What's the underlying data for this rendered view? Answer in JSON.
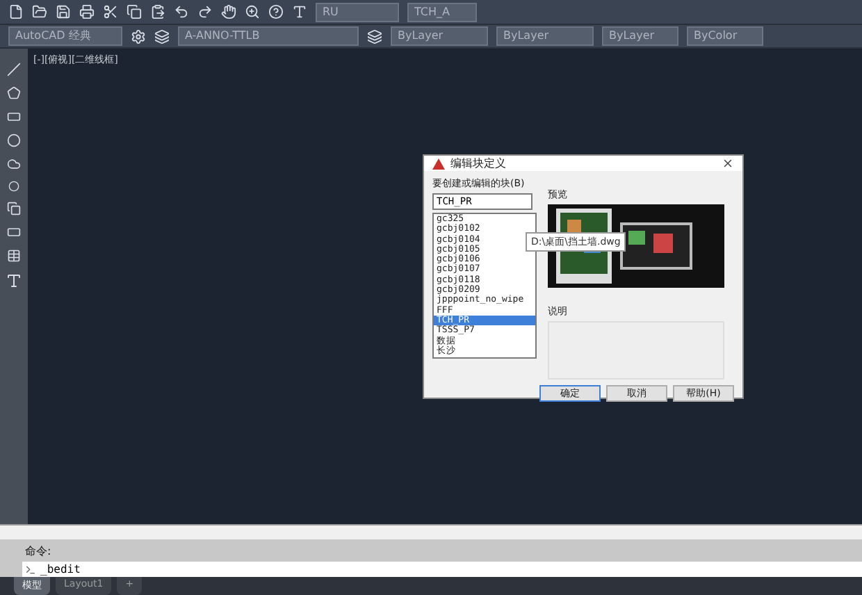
{
  "toolbar": {
    "style_field": "RU",
    "style_field_2": "TCH_A",
    "workspace": "AutoCAD 经典",
    "layer": "A-ANNO-TTLB",
    "color_field": "ByLayer",
    "linetype": "ByLayer",
    "lineweight": "ByLayer",
    "plot_style": "ByColor"
  },
  "viewport": {
    "label": "[-][俯视][二维线框]"
  },
  "dialog": {
    "title": "编辑块定义",
    "block_label": "要创建或编辑的块(B)",
    "block_value": "TCH_PR",
    "blocks": [
      {
        "name": "gc325",
        "selected": false
      },
      {
        "name": "gcbj0102",
        "selected": false
      },
      {
        "name": "gcbj0104",
        "selected": false
      },
      {
        "name": "gcbj0105",
        "selected": false
      },
      {
        "name": "gcbj0106",
        "selected": false
      },
      {
        "name": "gcbj0107",
        "selected": false
      },
      {
        "name": "gcbj0118",
        "selected": false
      },
      {
        "name": "gcbj0209",
        "selected": false
      },
      {
        "name": "jpppoint_no_wipe",
        "selected": false
      },
      {
        "name": "FFF",
        "selected": false
      },
      {
        "name": "TCH_PR",
        "selected": true
      },
      {
        "name": "TSSS_P7",
        "selected": false
      },
      {
        "name": "数据",
        "selected": false
      },
      {
        "name": "长沙",
        "selected": false
      }
    ],
    "tooltip": "D:\\桌面\\挡土墙.dwg",
    "preview_label": "预览",
    "description_label": "说明",
    "buttons": [
      "确定",
      "取消",
      "帮助(H)"
    ]
  },
  "command": {
    "history": "命令:",
    "input": "_bedit"
  },
  "layout_tabs": [
    {
      "label": "模型",
      "selected": true
    },
    {
      "label": "Layout1",
      "selected": false
    },
    {
      "label": "+",
      "selected": false
    }
  ]
}
